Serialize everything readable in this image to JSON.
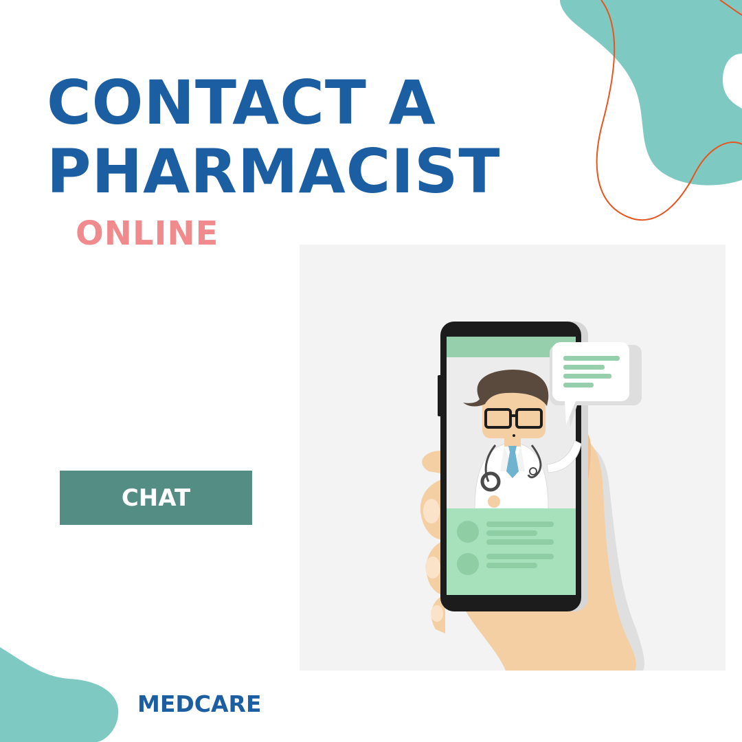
{
  "headline": {
    "line1": "CONTACT A",
    "line2": "PHARMACIST"
  },
  "subheadline": "ONLINE",
  "cta": {
    "label": "CHAT"
  },
  "brand": "MEDCARE",
  "colors": {
    "primary": "#1b5ea2",
    "accent": "#f08a8d",
    "teal": "#7ecac2",
    "button": "#548d84",
    "line": "#e8541e"
  },
  "illustration": {
    "subject": "pharmacist-video-call-on-phone",
    "icons": [
      "phone-icon",
      "pharmacist-avatar",
      "chat-bubble-icon",
      "stethoscope-icon"
    ]
  }
}
